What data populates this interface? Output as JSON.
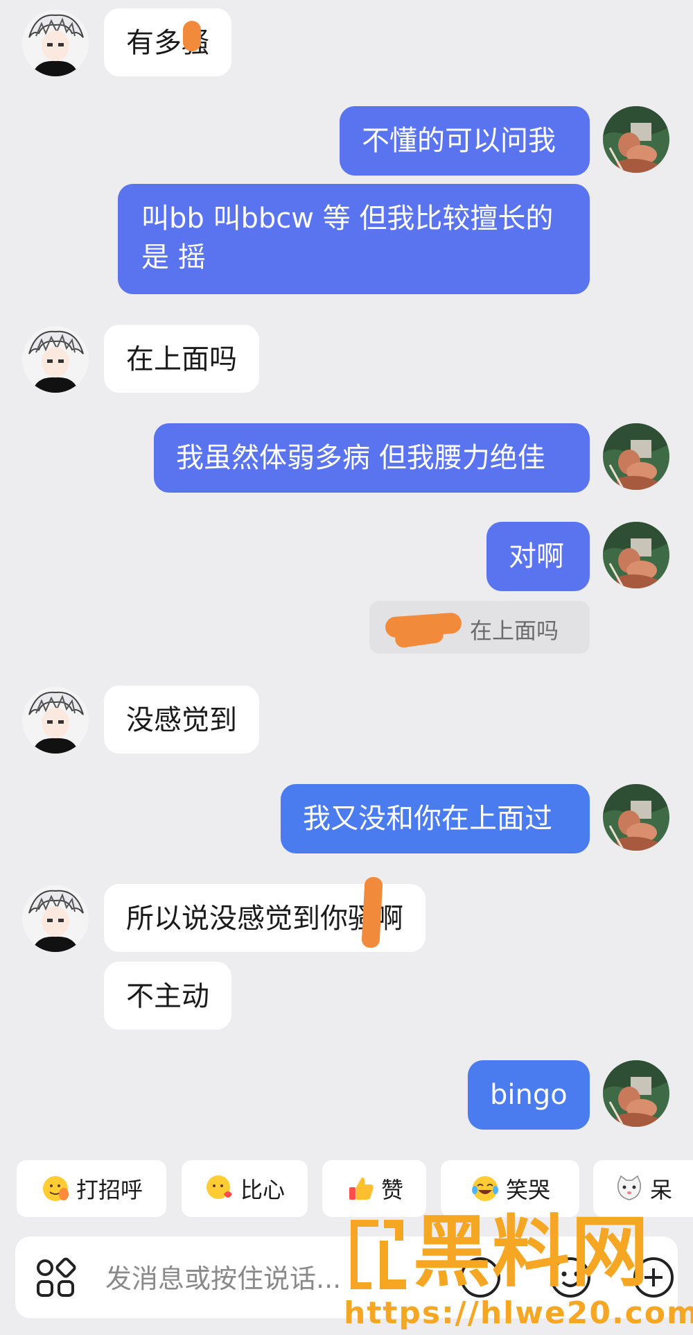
{
  "messages": {
    "m1": "有多骚",
    "m2": "不懂的可以问我",
    "m3": "叫bb 叫bbcw 等 但我比较擅长的是 摇",
    "m4": "在上面吗",
    "m5": "我虽然体弱多病 但我腰力绝佳",
    "m6": "对啊",
    "m6_quote": "在上面吗",
    "m7": "没感觉到",
    "m8": "我又没和你在上面过",
    "m9": "所以说没感觉到你骚啊",
    "m10": "不主动",
    "m11": "bingo"
  },
  "quick_replies": [
    {
      "label": "打招呼",
      "icon": "wave-emoji-icon"
    },
    {
      "label": "比心",
      "icon": "heart-hands-emoji-icon"
    },
    {
      "label": "赞",
      "icon": "thumbs-up-emoji-icon"
    },
    {
      "label": "笑哭",
      "icon": "laugh-cry-emoji-icon"
    },
    {
      "label": "呆",
      "icon": "cat-emoji-icon"
    }
  ],
  "input": {
    "placeholder": "发消息或按住说话..."
  },
  "watermark": {
    "brand": "黑料网",
    "url": "https://hlwe20.com"
  },
  "colors": {
    "outgoing_bubble": "#5a73ef",
    "incoming_bubble": "#ffffff",
    "background": "#ededef",
    "watermark": "#f5a623"
  }
}
